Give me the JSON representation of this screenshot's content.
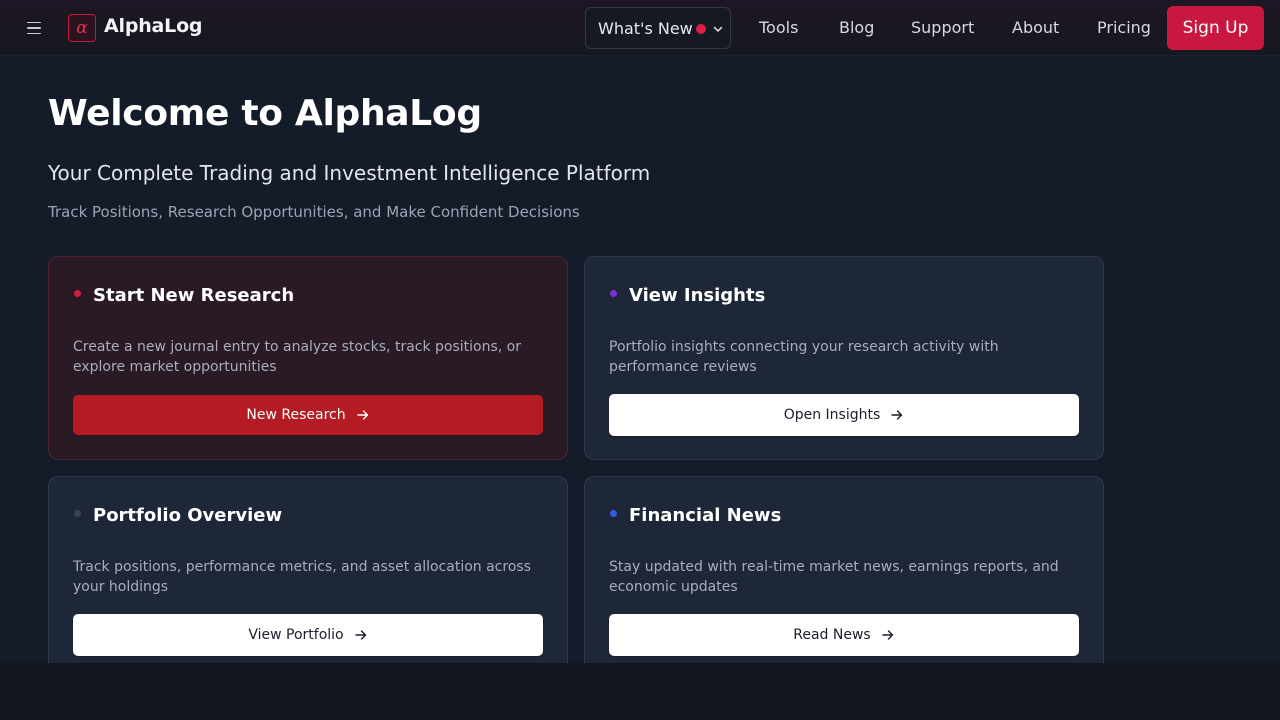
{
  "header": {
    "logo_glyph": "α",
    "logo_text": "AlphaLog",
    "whats_new_label": "What's New",
    "nav": [
      "Tools",
      "Blog",
      "Support",
      "About",
      "Pricing"
    ],
    "signup_label": "Sign Up"
  },
  "hero": {
    "title": "Welcome to AlphaLog",
    "subtitle": "Your Complete Trading and Investment Intelligence Platform",
    "tagline": "Track Positions, Research Opportunities, and Make Confident Decisions"
  },
  "cards": [
    {
      "title": "Start New Research",
      "description": "Create a new journal entry to analyze stocks, track positions, or explore market opportunities",
      "button": "New Research",
      "bullet_color": "#d11f3c"
    },
    {
      "title": "View Insights",
      "description": "Portfolio insights connecting your research activity with performance reviews",
      "button": "Open Insights",
      "bullet_color": "#7b2fd6"
    },
    {
      "title": "Portfolio Overview",
      "description": "Track positions, performance metrics, and asset allocation across your holdings",
      "button": "View Portfolio",
      "bullet_color": "#3a4256"
    },
    {
      "title": "Financial News",
      "description": "Stay updated with real-time market news, earnings reports, and economic updates",
      "button": "Read News",
      "bullet_color": "#2e5fe0"
    }
  ],
  "colors": {
    "accent": "#c8183f",
    "background": "#141b29",
    "card": "#1e2737"
  },
  "icons": [
    "menu-icon",
    "alpha-logo-icon",
    "notification-dot-icon",
    "chevron-down-icon",
    "arrow-right-icon"
  ]
}
